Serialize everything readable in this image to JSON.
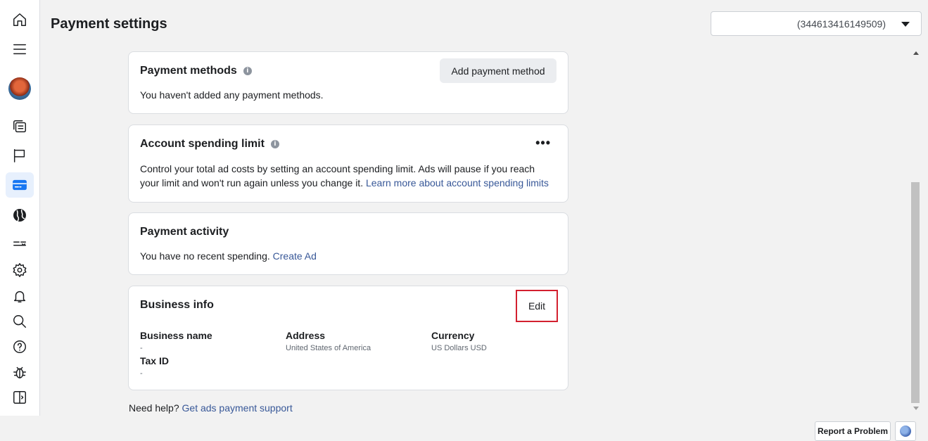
{
  "page": {
    "title": "Payment settings"
  },
  "account_selector": {
    "value": "(344613416149509)"
  },
  "sidebar": {
    "icons": [
      "home-icon",
      "menu-icon",
      "avatar",
      "pages-icon",
      "flag-icon",
      "billing-card-icon",
      "globe-icon",
      "tools-icon",
      "settings-gear-icon",
      "notifications-bell-icon",
      "search-icon",
      "help-icon",
      "bug-report-icon",
      "sidebar-toggle-icon"
    ],
    "active": "billing-card-icon"
  },
  "payment_methods": {
    "title": "Payment methods",
    "button": "Add payment method",
    "text": "You haven't added any payment methods."
  },
  "spending_limit": {
    "title": "Account spending limit",
    "more": "•••",
    "text_line1": "Control your total ad costs by setting an account spending limit. Ads will pause if you reach",
    "text_line2": "your limit and won't run again unless you change it.",
    "link": "Learn more about account spending limits"
  },
  "payment_activity": {
    "title": "Payment activity",
    "text": "You have no recent spending.",
    "link": "Create Ad"
  },
  "business_info": {
    "title": "Business info",
    "edit": "Edit",
    "fields": {
      "business_name": {
        "label": "Business name",
        "value": "-"
      },
      "address": {
        "label": "Address",
        "value": "United States of America"
      },
      "currency": {
        "label": "Currency",
        "value": "US Dollars USD"
      },
      "tax_id": {
        "label": "Tax ID",
        "value": "-"
      }
    }
  },
  "help": {
    "text": "Need help?",
    "link": "Get ads payment support"
  },
  "footer": {
    "report": "Report a Problem"
  },
  "colors": {
    "accent": "#1877f2",
    "link": "#385898",
    "highlight_border": "#d3202f"
  }
}
